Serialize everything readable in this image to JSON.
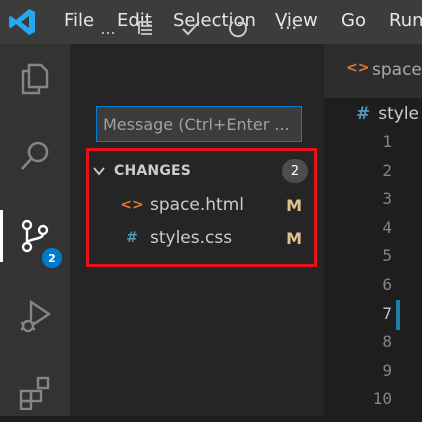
{
  "menu": [
    "File",
    "Edit",
    "Selection",
    "View",
    "Go",
    "Run"
  ],
  "activity_bar": {
    "items": [
      "explorer-icon",
      "search-icon",
      "source-control-icon",
      "run-debug-icon",
      "extensions-icon"
    ],
    "source_control_badge": "2"
  },
  "scm": {
    "toolbar": [
      "more-actions-icon",
      "view-as-tree-icon",
      "commit-check-icon",
      "refresh-icon",
      "ellipsis-icon"
    ],
    "toolbar_more": "...",
    "toolbar_ellipsis": "···",
    "message_placeholder": "Message (Ctrl+Enter ...",
    "changes_label": "CHANGES",
    "changes_count": "2",
    "files": [
      {
        "icon": "html-file-icon",
        "icon_glyph": "<>",
        "icon_color": "#e37933",
        "name": "space.html",
        "status": "M"
      },
      {
        "icon": "css-file-icon",
        "icon_glyph": "#",
        "icon_color": "#519aba",
        "name": "styles.css",
        "status": "M"
      }
    ],
    "status_color": "#e2c08d",
    "highlight_color": "#e3121b"
  },
  "editor": {
    "tab_label": "space",
    "breadcrumb_label": "style",
    "line_numbers": [
      "1",
      "2",
      "3",
      "4",
      "5",
      "6",
      "7",
      "8",
      "9",
      "10"
    ],
    "current_line": "7"
  }
}
